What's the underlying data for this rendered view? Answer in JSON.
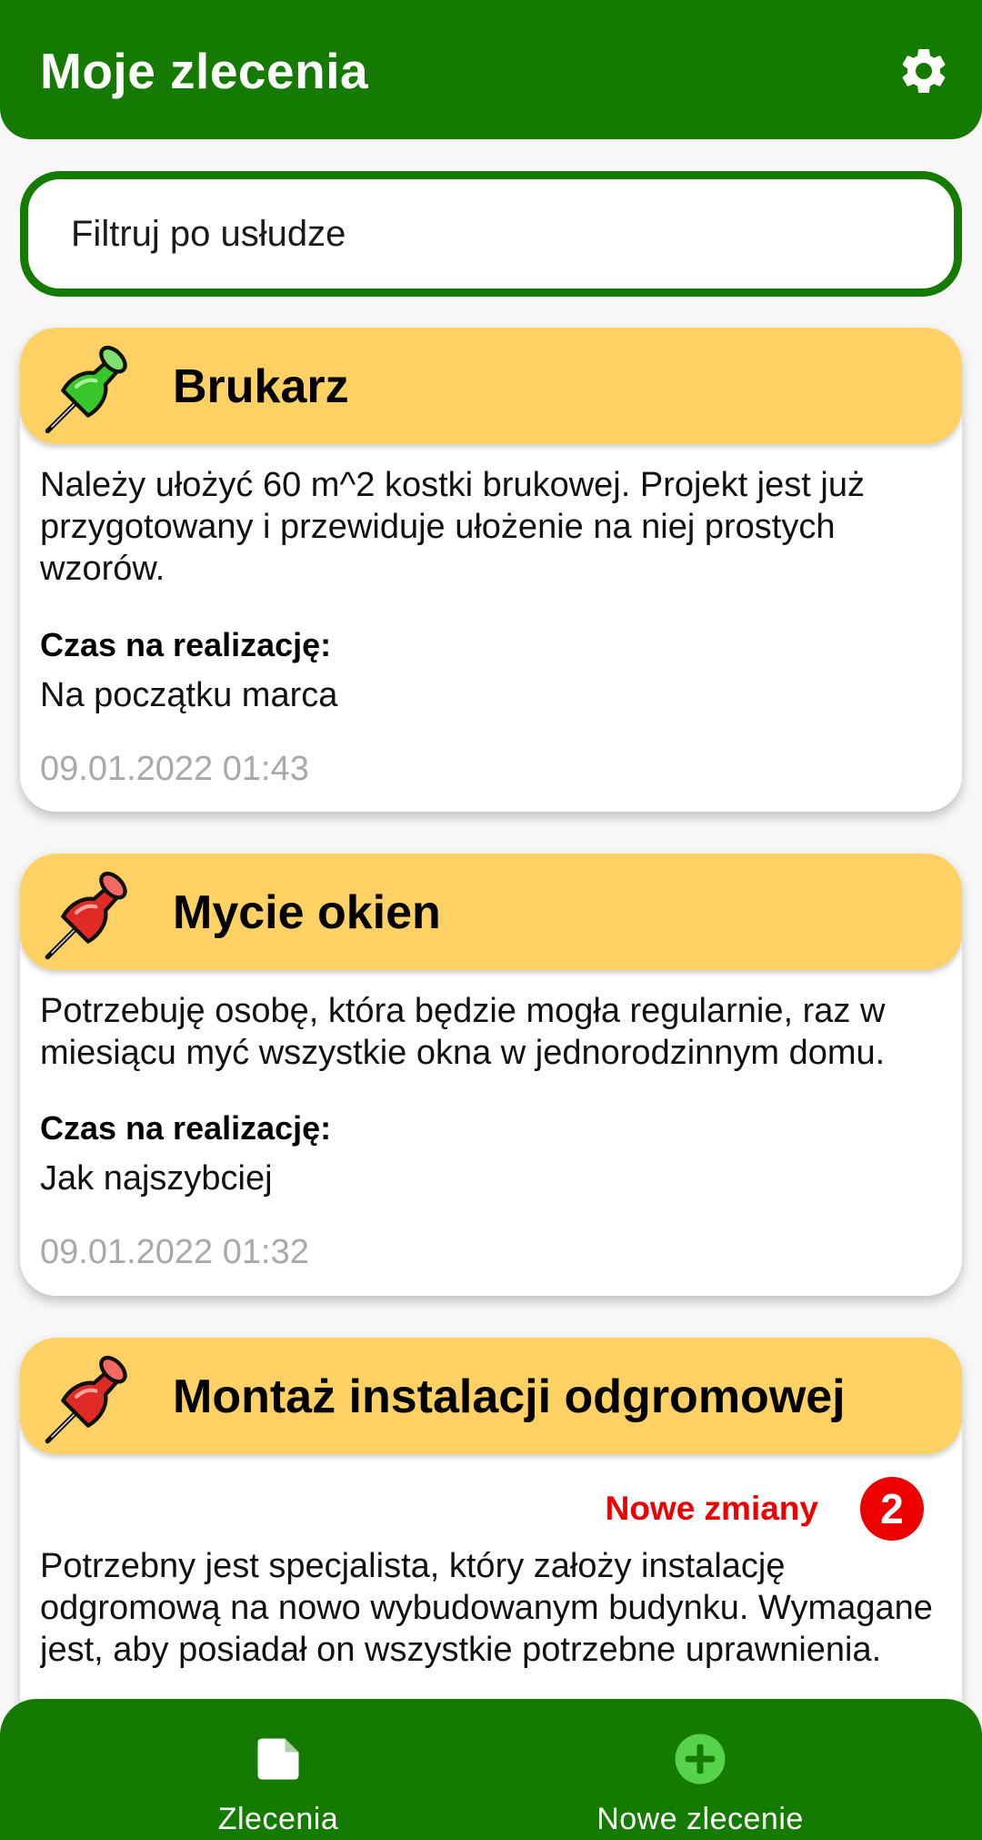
{
  "header": {
    "title": "Moje zlecenia",
    "settings_icon": "gear-icon"
  },
  "filter": {
    "placeholder": "Filtruj po usłudze",
    "value": ""
  },
  "orders": [
    {
      "title": "Brukarz",
      "pin_color": "#38c72a",
      "pin_icon": "pushpin-green-icon",
      "description": "Należy ułożyć 60 m^2 kostki brukowej. Projekt jest już przygotowany i przewiduje ułożenie na niej prostych wzorów.",
      "time_label": "Czas na realizację:",
      "time_value": "Na początku marca",
      "date": "09.01.2022 01:43"
    },
    {
      "title": "Mycie okien",
      "pin_color": "#e02a25",
      "pin_icon": "pushpin-red-icon",
      "description": "Potrzebuję osobę, która będzie mogła regularnie, raz w miesiącu myć wszystkie okna w jednorodzinnym domu.",
      "time_label": "Czas na realizację:",
      "time_value": "Jak najszybciej",
      "date": "09.01.2022 01:32"
    },
    {
      "title": "Montaż instalacji odgromowej",
      "pin_color": "#e02a25",
      "pin_icon": "pushpin-red-icon",
      "changes_label": "Nowe zmiany",
      "changes_count": "2",
      "description": "Potrzebny jest specjalista, który założy instalację odgromową na nowo wybudowanym budynku. Wymagane jest, aby posiadał on wszystkie potrzebne uprawnienia."
    }
  ],
  "bottom_nav": [
    {
      "label": "Zlecenia",
      "icon": "document-icon"
    },
    {
      "label": "Nowe zlecenie",
      "icon": "add-circle-icon"
    }
  ],
  "colors": {
    "primary": "#157a00",
    "card_header": "#fdd164",
    "alert": "#ee0000",
    "date_text": "#a9a9a9",
    "add_icon": "#57d34b"
  }
}
